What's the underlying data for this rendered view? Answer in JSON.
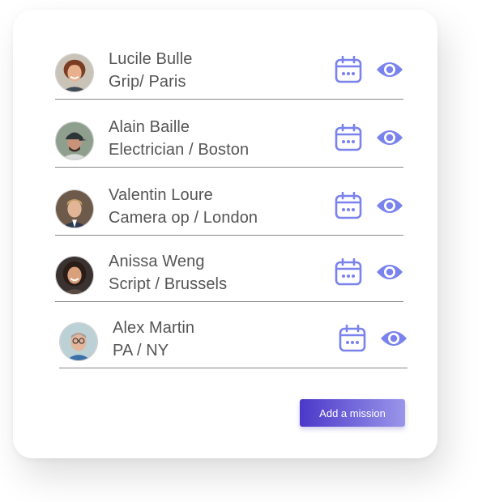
{
  "colors": {
    "icon_accent": "#7a82ee",
    "button_gradient_start": "#4b38c9",
    "button_gradient_end": "#9a96ea"
  },
  "people": [
    {
      "name": "Lucile Bulle",
      "role": "Grip/ Paris",
      "avatar": "avatar-woman-short-hair"
    },
    {
      "name": "Alain Baille",
      "role": "Electrician / Boston",
      "avatar": "avatar-man-cap"
    },
    {
      "name": "Valentin Loure",
      "role": "Camera op / London",
      "avatar": "avatar-man-blond"
    },
    {
      "name": "Anissa Weng",
      "role": "Script / Brussels",
      "avatar": "avatar-woman-long-hair"
    },
    {
      "name": "Alex Martin",
      "role": "PA / NY",
      "avatar": "avatar-man-glasses"
    }
  ],
  "row_icons": {
    "calendar": "calendar-icon",
    "view": "eye-icon"
  },
  "actions": {
    "add_mission_label": "Add a mission"
  }
}
